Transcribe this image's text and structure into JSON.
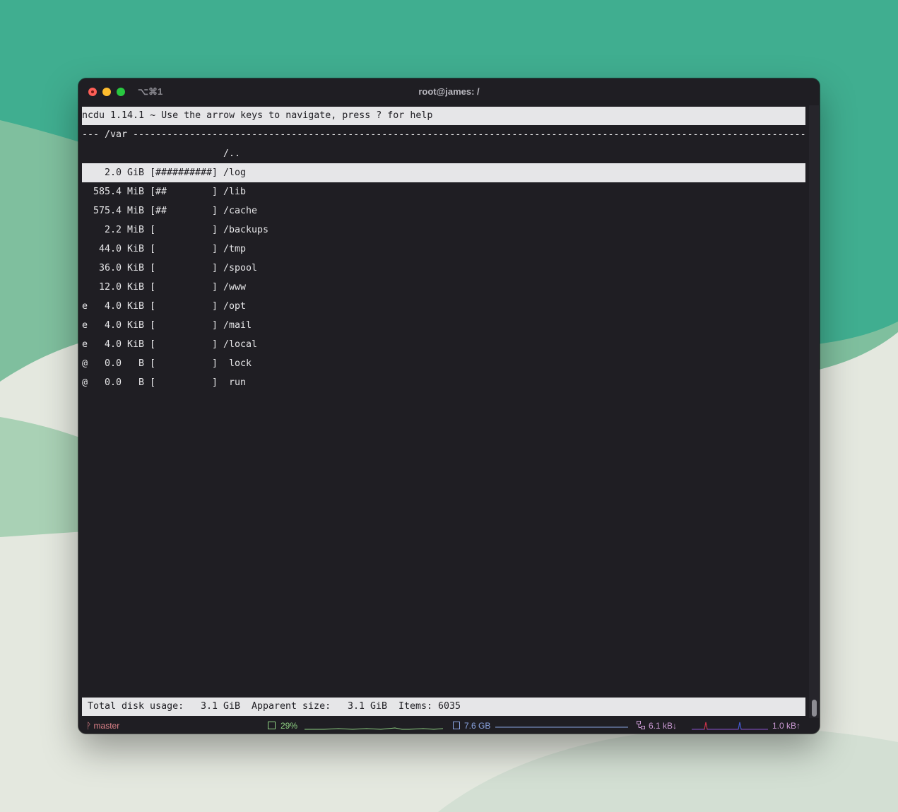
{
  "window": {
    "title": "root@james: /",
    "tab_shortcut": "⌥⌘1"
  },
  "ncdu": {
    "header": "ncdu 1.14.1 ~ Use the arrow keys to navigate, press ? for help",
    "path_line": "--- /var ----------------------------------------------------------------------------------------------------------------------------",
    "parent_entry": "/..",
    "rows": [
      {
        "flag": "",
        "size": "2.0 GiB",
        "bar": "[##########]",
        "name": "/log",
        "selected": true
      },
      {
        "flag": "",
        "size": "585.4 MiB",
        "bar": "[##        ]",
        "name": "/lib"
      },
      {
        "flag": "",
        "size": "575.4 MiB",
        "bar": "[##        ]",
        "name": "/cache"
      },
      {
        "flag": "",
        "size": "2.2 MiB",
        "bar": "[          ]",
        "name": "/backups"
      },
      {
        "flag": "",
        "size": "44.0 KiB",
        "bar": "[          ]",
        "name": "/tmp"
      },
      {
        "flag": "",
        "size": "36.0 KiB",
        "bar": "[          ]",
        "name": "/spool"
      },
      {
        "flag": "",
        "size": "12.0 KiB",
        "bar": "[          ]",
        "name": "/www"
      },
      {
        "flag": "e",
        "size": "4.0 KiB",
        "bar": "[          ]",
        "name": "/opt"
      },
      {
        "flag": "e",
        "size": "4.0 KiB",
        "bar": "[          ]",
        "name": "/mail"
      },
      {
        "flag": "e",
        "size": "4.0 KiB",
        "bar": "[          ]",
        "name": "/local"
      },
      {
        "flag": "@",
        "size": "0.0   B",
        "bar": "[          ]",
        "name": " lock"
      },
      {
        "flag": "@",
        "size": "0.0   B",
        "bar": "[          ]",
        "name": " run"
      }
    ],
    "footer": {
      "disk_label": "Total disk usage:",
      "disk_value": "3.1 GiB",
      "apparent_label": "Apparent size:",
      "apparent_value": "3.1 GiB",
      "items_label": "Items:",
      "items_value": "6035"
    }
  },
  "statusbar": {
    "git_branch": "master",
    "cpu": "29%",
    "memory": "7.6 GB",
    "net_down": "6.1 kB↓",
    "net_up": "1.0 kB↑",
    "colors": {
      "cpu": "#8fd283",
      "memory": "#8aa4e0",
      "net": "#cb9ad4",
      "download_spike": "#d8303a",
      "upload_spike": "#3b5cd6"
    }
  },
  "icons": [
    "git-branch-icon",
    "cpu-icon",
    "memory-icon",
    "network-icon"
  ]
}
